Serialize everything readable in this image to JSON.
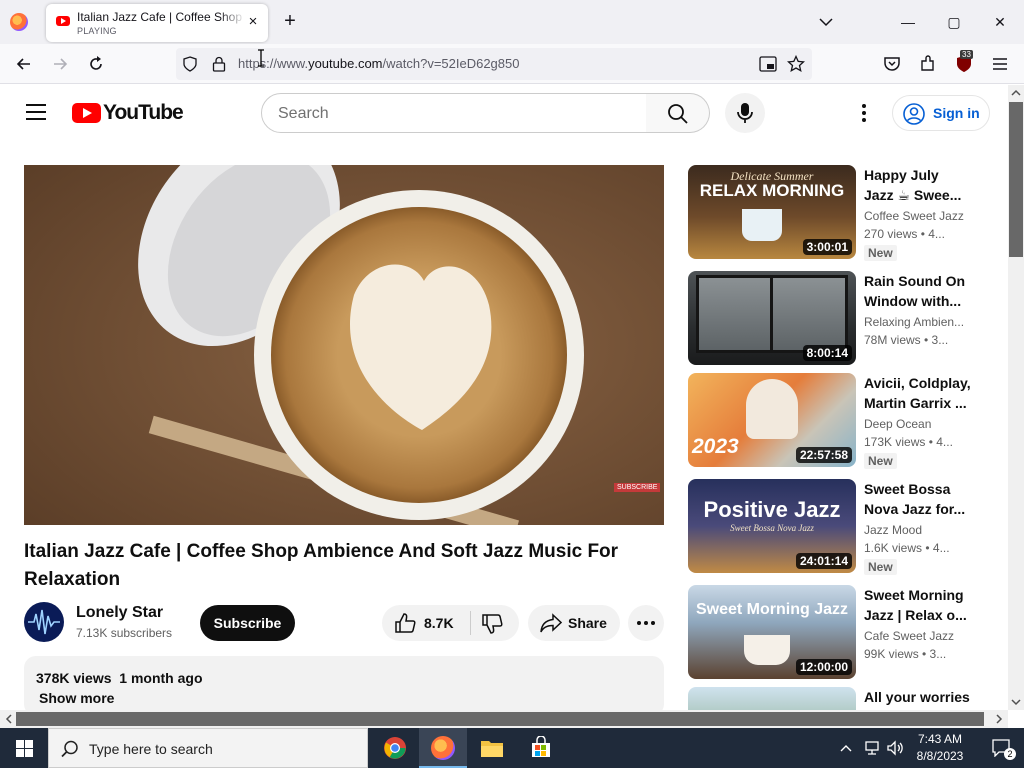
{
  "browser": {
    "tab": {
      "title": "Italian Jazz Cafe | Coffee Shop Ambience",
      "subtitle": "PLAYING",
      "close": "×"
    },
    "new_tab": "+",
    "window_controls": {
      "minimize": "—",
      "maximize": "▢",
      "close": "✕"
    },
    "url": {
      "prefix": "https://www.",
      "domain": "youtube.com",
      "path": "/watch?v=52IeD62g850"
    },
    "extension_badge": "33"
  },
  "youtube": {
    "logo_text": "YouTube",
    "search_placeholder": "Search",
    "sign_in": "Sign in",
    "video": {
      "title": "Italian Jazz Cafe | Coffee Shop Ambience And Soft Jazz Music For Relaxation",
      "subscribe_overlay": "SUBSCRIBE"
    },
    "channel": {
      "name": "Lonely Star",
      "subscribers": "7.13K subscribers",
      "subscribe_label": "Subscribe"
    },
    "actions": {
      "likes": "8.7K",
      "share": "Share"
    },
    "description": {
      "stats": "378K views  1 month ago",
      "more": "Show more"
    },
    "recommendations": [
      {
        "title": "Happy July Jazz ☕ Swee...",
        "channel": "Coffee Sweet Jazz",
        "meta": "270 views • 4...",
        "duration": "3:00:01",
        "badge": "New",
        "thumb_caption": "Delicate Summer",
        "thumb_big": "RELAX MORNING"
      },
      {
        "title": "Rain Sound On Window with...",
        "channel": "Relaxing Ambien...",
        "meta": "78M views • 3...",
        "duration": "8:00:14",
        "badge": "",
        "thumb_caption": "",
        "thumb_big": ""
      },
      {
        "title": "Avicii, Coldplay, Martin Garrix ...",
        "channel": "Deep Ocean",
        "meta": "173K views • 4...",
        "duration": "22:57:58",
        "badge": "New",
        "thumb_caption": "",
        "thumb_big": "2023"
      },
      {
        "title": "Sweet Bossa Nova Jazz for...",
        "channel": "Jazz Mood",
        "meta": "1.6K views • 4...",
        "duration": "24:01:14",
        "badge": "New",
        "thumb_caption": "Sweet Bossa Nova Jazz",
        "thumb_big": "Positive Jazz"
      },
      {
        "title": "Sweet Morning Jazz | Relax o...",
        "channel": "Cafe Sweet Jazz",
        "meta": "99K views • 3...",
        "duration": "12:00:00",
        "badge": "",
        "thumb_caption": "",
        "thumb_big": "Sweet Morning Jazz"
      },
      {
        "title": "All your worries",
        "channel": "",
        "meta": "",
        "duration": "",
        "badge": "",
        "thumb_caption": "",
        "thumb_big": ""
      }
    ]
  },
  "taskbar": {
    "search_placeholder": "Type here to search",
    "time": "7:43 AM",
    "date": "8/8/2023",
    "notifications": "2"
  },
  "colors": {
    "youtube_red": "#ff0000",
    "link_blue": "#065fd4",
    "taskbar": "#1f2a3a"
  }
}
